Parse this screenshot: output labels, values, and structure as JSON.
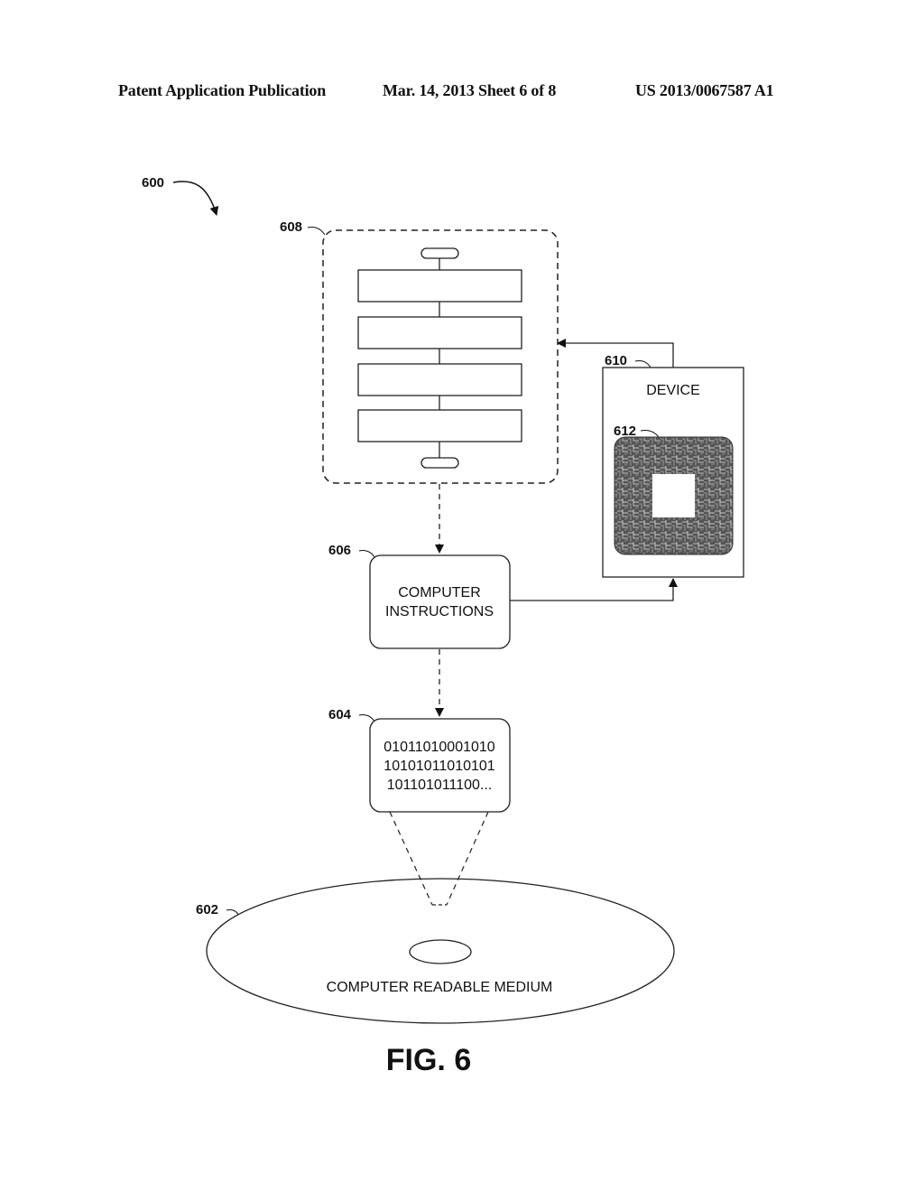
{
  "header": {
    "left": "Patent Application Publication",
    "center": "Mar. 14, 2013  Sheet 6 of 8",
    "right": "US 2013/0067587 A1"
  },
  "figure": {
    "overall_ref": "600",
    "caption": "FIG. 6",
    "flowchart": {
      "ref": "608",
      "step_count": 4
    },
    "device": {
      "ref": "610",
      "label": "DEVICE",
      "chip_ref": "612"
    },
    "instructions": {
      "ref": "606",
      "line1": "COMPUTER",
      "line2": "INSTRUCTIONS"
    },
    "data": {
      "ref": "604",
      "lines": [
        "01011010001010",
        "10101011010101",
        "101101011100..."
      ]
    },
    "medium": {
      "ref": "602",
      "label": "COMPUTER READABLE MEDIUM"
    }
  }
}
